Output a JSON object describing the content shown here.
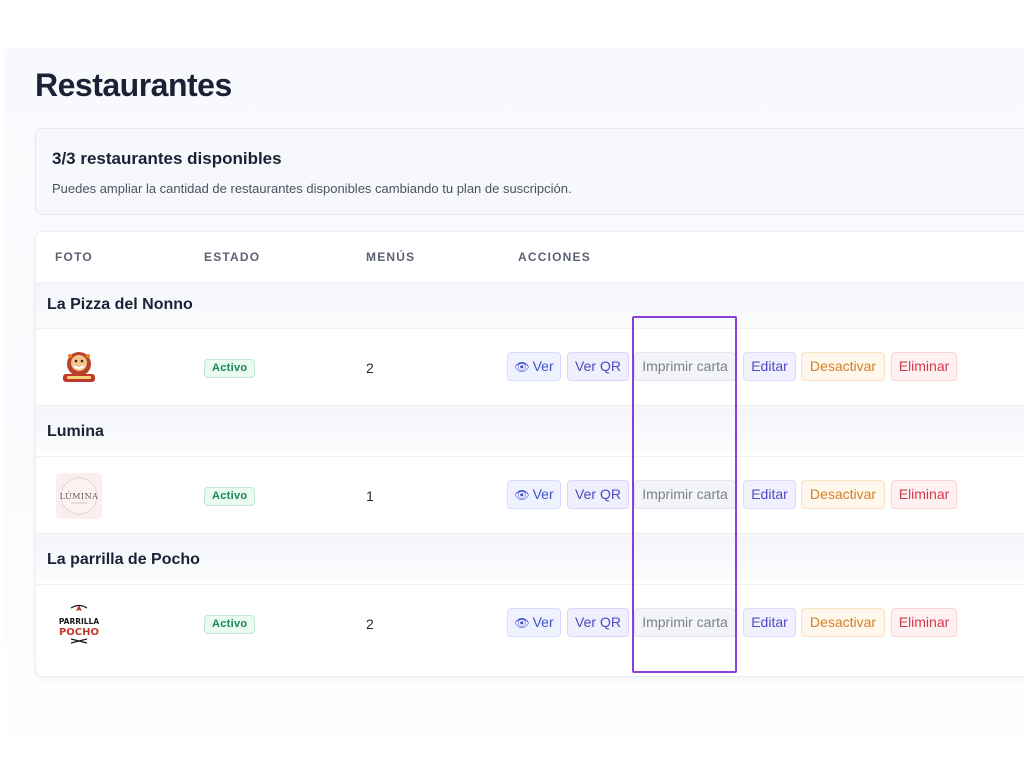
{
  "page": {
    "title": "Restaurantes"
  },
  "info": {
    "title": "3/3 restaurantes disponibles",
    "text": "Puedes ampliar la cantidad de restaurantes disponibles cambiando tu plan de suscripción."
  },
  "table": {
    "headers": {
      "photo": "FOTO",
      "status": "ESTADO",
      "menus": "MENÚS",
      "actions": "ACCIONES"
    }
  },
  "restaurants": [
    {
      "name": "La Pizza del Nonno",
      "status": "Activo",
      "menus": "2",
      "logo": "pizza-logo"
    },
    {
      "name": "Lumina",
      "status": "Activo",
      "menus": "1",
      "logo": "lumina-logo",
      "logo_text": "LÚMINA"
    },
    {
      "name": "La parrilla de Pocho",
      "status": "Activo",
      "menus": "2",
      "logo": "parrilla-logo",
      "logo_text_top": "PARRILLA",
      "logo_text_bottom": "POCHO"
    }
  ],
  "actions": {
    "view": "Ver",
    "qr": "Ver QR",
    "print": "Imprimir carta",
    "edit": "Editar",
    "deactivate": "Desactivar",
    "delete": "Eliminar",
    "view_icon": "eye-icon"
  },
  "colors": {
    "accent": "#5048c6",
    "status_active": "#16875a",
    "highlight": "#8a3fd8",
    "danger": "#d03a48",
    "warning": "#d3802a"
  }
}
